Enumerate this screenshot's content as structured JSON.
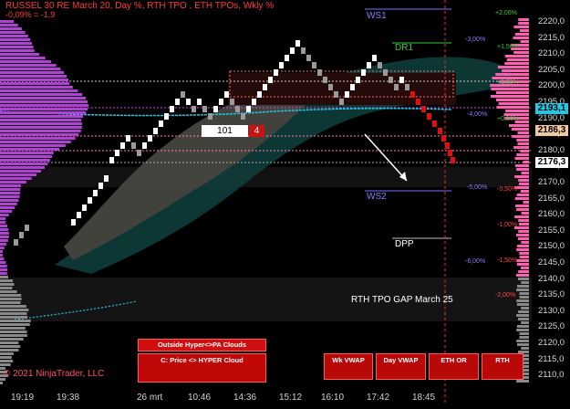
{
  "header": {
    "title": "RUSSEL 30 RE March 20, Day %, RTH TPO , ETH TPOs, Wkly %",
    "subtitle": "-0,09% = -1,9"
  },
  "copyright": "© 2021 NinjaTrader, LLC",
  "price_axis": {
    "labels": [
      "2220,0",
      "2215,0",
      "2210,0",
      "2205,0",
      "2200,0",
      "2195,0",
      "2190,0",
      "2185,0",
      "2180,0",
      "2175,0",
      "2170,0",
      "2165,0",
      "2160,0",
      "2155,0",
      "2150,0",
      "2145,0",
      "2140,0",
      "2135,0",
      "2130,0",
      "2125,0",
      "2120,0",
      "2115,0",
      "2110,0"
    ],
    "markers": [
      {
        "label": "2193,1",
        "color": "#1ec8e6"
      },
      {
        "label": "2186,3",
        "color": "#f0c8a0"
      },
      {
        "label": "2176,3",
        "color": "#ffffff"
      }
    ]
  },
  "time_axis": [
    "19:19",
    "19:38",
    "26 mrt",
    "10:46",
    "14:36",
    "15:12",
    "16:10",
    "17:42",
    "18:45"
  ],
  "levels": {
    "ws1": "WS1",
    "dr1": "DR1",
    "ws2": "WS2",
    "dpp": "DPP"
  },
  "percent_labels": {
    "p206": "+2,06%",
    "p150": "+1,50%",
    "p100": "+1,00%",
    "p050": "+0,50%",
    "m050": "-0,50%",
    "m100": "-1,00%",
    "m150": "-1,50%",
    "m200": "-2,00%",
    "m300": "-3,00%",
    "m400": "-4,00%",
    "m500": "-5,00%",
    "m600": "-6,00%"
  },
  "annotation": "RTH TPO GAP March 25",
  "counter": {
    "value": "101",
    "badge": "4"
  },
  "buttons": {
    "outside_hyper": "Outside Hyper<>PA Clouds",
    "price_hyper": "C: Price <> HYPER Cloud",
    "wk_vwap": "Wk VWAP",
    "day_vwap": "Day VWAP",
    "eth_or": "ETH OR",
    "rth": "RTH"
  },
  "colors": {
    "up_bar": "#ffffff",
    "flat_bar": "#9a9a9a",
    "down_bar": "#e01010",
    "profile_left": "#b23fd6",
    "profile_right": "#ff5fb3",
    "accent_cyan": "#1ec8e6",
    "dr1": "#37c837",
    "ws": "#8a7cff"
  }
}
